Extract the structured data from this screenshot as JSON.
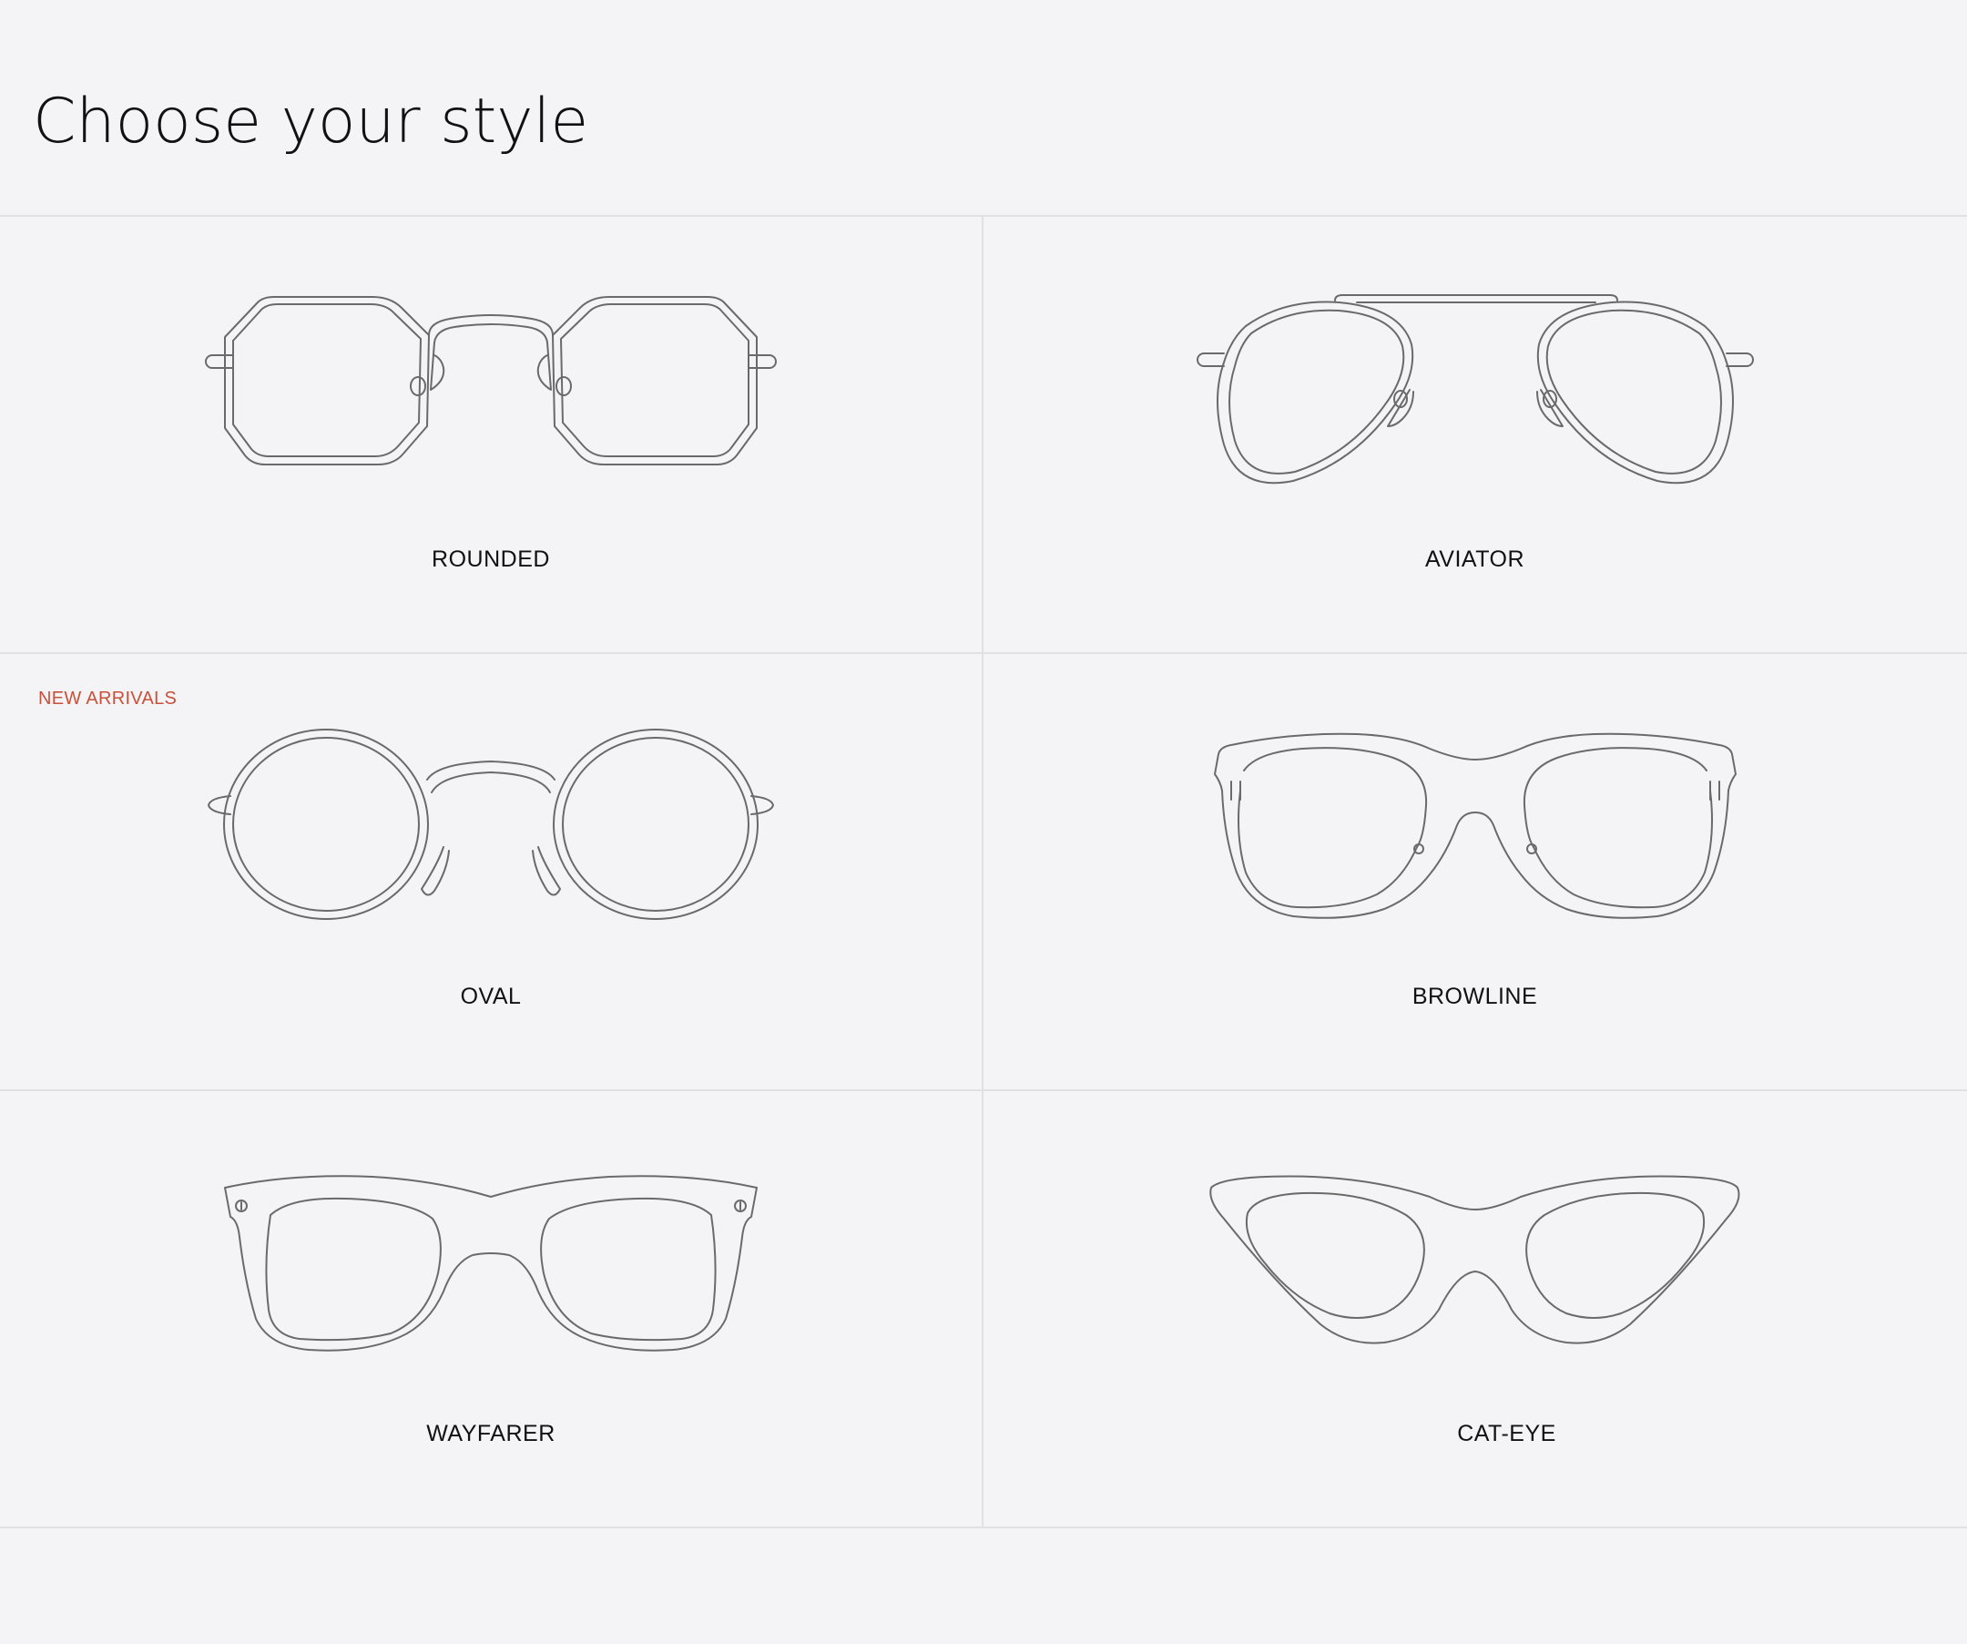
{
  "page": {
    "title": "Choose your style"
  },
  "colors": {
    "background": "#f4f4f6",
    "badge": "#c9503a",
    "line": "#6a6a6a",
    "divider": "#e1e1e4"
  },
  "styles": [
    {
      "label": "ROUNDED",
      "icon": "rounded-glasses-icon"
    },
    {
      "label": "AVIATOR",
      "icon": "aviator-glasses-icon"
    },
    {
      "label": "OVAL",
      "icon": "oval-glasses-icon",
      "badge": "NEW ARRIVALS"
    },
    {
      "label": "BROWLINE",
      "icon": "browline-glasses-icon"
    },
    {
      "label": "WAYFARER",
      "icon": "wayfarer-glasses-icon"
    },
    {
      "label": "CAT-EYE",
      "icon": "cat-eye-glasses-icon"
    }
  ]
}
